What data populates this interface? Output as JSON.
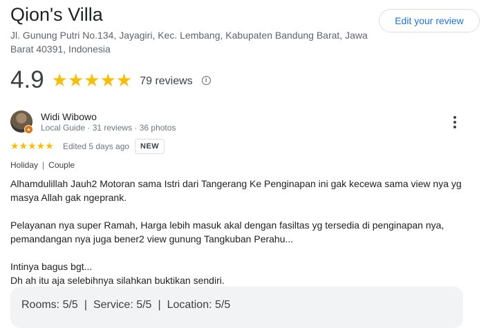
{
  "place": {
    "title": "Qion's Villa",
    "address": "Jl. Gunung Putri No.134, Jayagiri, Kec. Lembang, Kabupaten Bandung Barat, Jawa Barat 40391, Indonesia",
    "edit_button": "Edit your review"
  },
  "summary": {
    "rating": "4.9",
    "stars": "★★★★★",
    "review_count": "79 reviews",
    "info_icon": "i"
  },
  "review": {
    "reviewer_name": "Widi Wibowo",
    "reviewer_meta": "Local Guide · 31 reviews · 36 photos",
    "stars": "★★★★★",
    "edited": "Edited 5 days ago",
    "new_badge": "NEW",
    "tag1": "Holiday",
    "tag_sep": "|",
    "tag2": "Couple",
    "text_lines": [
      "Alhamdulillah Jauh2 Motoran sama Istri dari Tangerang Ke Penginapan ini gak kecewa sama view nya yg masya Allah gak ngeprank.",
      "Pelayanan nya super Ramah, Harga lebih masuk akal dengan fasiltas yg tersedia di penginapan nya, pemandangan nya juga bener2 view gunung Tangkuban Perahu...",
      "Intinya bagus bgt...",
      "Dh ah itu aja selebihnya silahkan buktikan sendiri."
    ],
    "sub_ratings": {
      "rooms": "Rooms: 5/5",
      "service": "Service: 5/5",
      "location": "Location: 5/5",
      "sep": "|"
    }
  },
  "colors": {
    "accent": "#1a73e8",
    "star": "#fbbc04",
    "local_guide_badge": "#e8710a"
  },
  "icons": {
    "info": "info-icon",
    "more": "more-vert-icon",
    "badge": "local-guide-icon"
  }
}
